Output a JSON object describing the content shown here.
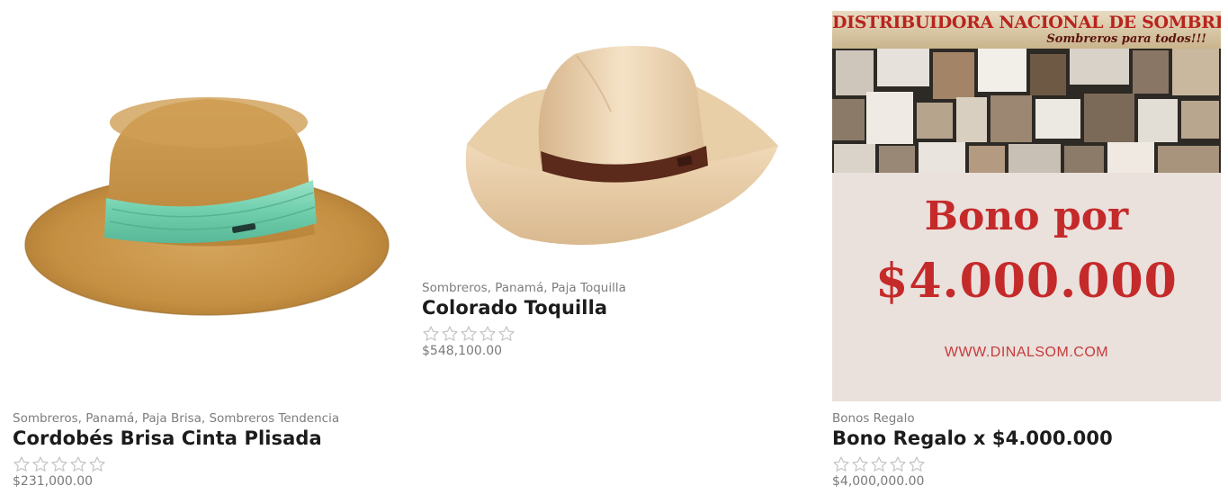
{
  "products": [
    {
      "categories": "Sombreros, Panamá, Paja Brisa, Sombreros Tendencia",
      "title": "Cordobés Brisa Cinta Plisada",
      "rating_stars": 0,
      "price": "$231,000.00",
      "image_icon": "boater-hat-with-mint-ribbon"
    },
    {
      "categories": "Sombreros, Panamá, Paja Toquilla",
      "title": "Colorado Toquilla",
      "rating_stars": 0,
      "price": "$548,100.00",
      "image_icon": "cowboy-hat-with-brown-band"
    },
    {
      "categories": "Bonos Regalo",
      "title": "Bono Regalo x $4.000.000",
      "rating_stars": 0,
      "price": "$4,000,000.00",
      "banner": {
        "heading": "DISTRIBUIDORA NACIONAL DE SOMBREROS",
        "tagline": "Sombreros para todos!!!",
        "line1": "Bono por",
        "line2": "$4.000.000",
        "url": "WWW.DINALSOM.COM"
      }
    }
  ],
  "colors": {
    "star_outline": "#c8c8c8",
    "banner_red": "#c52a2a",
    "banner_bg": "#eae0dc"
  }
}
